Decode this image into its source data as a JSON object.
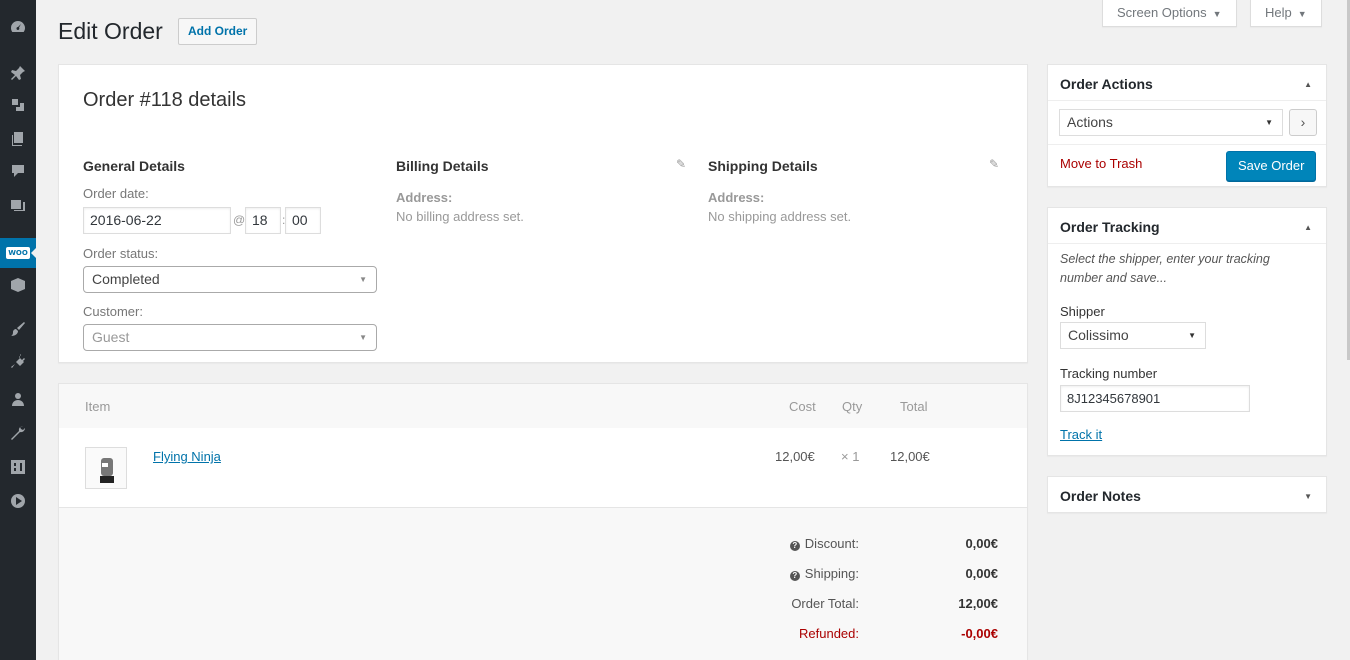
{
  "header": {
    "title": "Edit Order",
    "add_order": "Add Order",
    "screen_options": "Screen Options",
    "help": "Help",
    "dropdown_glyph": "▼"
  },
  "order": {
    "title": "Order #118 details",
    "general": {
      "heading": "General Details",
      "date_label": "Order date:",
      "date": "2016-06-22",
      "at": "@",
      "hour": "18",
      "colon": ":",
      "minute": "00",
      "status_label": "Order status:",
      "status": "Completed",
      "customer_label": "Customer:",
      "customer_placeholder": "Guest"
    },
    "billing": {
      "heading": "Billing Details",
      "address_label": "Address:",
      "address": "No billing address set."
    },
    "shipping": {
      "heading": "Shipping Details",
      "address_label": "Address:",
      "address": "No shipping address set."
    }
  },
  "items": {
    "columns": {
      "item": "Item",
      "cost": "Cost",
      "qty": "Qty",
      "total": "Total"
    },
    "rows": [
      {
        "name": "Flying Ninja",
        "cost": "12,00€",
        "qty": "× 1",
        "total": "12,00€"
      }
    ],
    "totals": {
      "discount_label": "Discount:",
      "discount": "0,00€",
      "shipping_label": "Shipping:",
      "shipping": "0,00€",
      "order_total_label": "Order Total:",
      "order_total": "12,00€",
      "refunded_label": "Refunded:",
      "refunded": "-0,00€"
    }
  },
  "order_actions": {
    "title": "Order Actions",
    "select_value": "Actions",
    "go": "›",
    "trash": "Move to Trash",
    "save": "Save Order"
  },
  "order_tracking": {
    "title": "Order Tracking",
    "note": "Select the shipper, enter your tracking number and save...",
    "shipper_label": "Shipper",
    "shipper": "Colissimo",
    "tracking_label": "Tracking number",
    "tracking_number": "8J12345678901",
    "track_link": "Track it"
  },
  "order_notes": {
    "title": "Order Notes"
  },
  "icons": {
    "menu": [
      "dashboard-icon",
      "pin-icon",
      "media-icon",
      "pages-icon",
      "comments-icon",
      "gallery-icon",
      "woocommerce-icon",
      "products-icon",
      "appearance-icon",
      "plugins-icon",
      "users-icon",
      "tools-icon",
      "settings-icon",
      "play-icon"
    ],
    "collapse": "▲",
    "expand": "▼",
    "pencil": "✎",
    "help": "?"
  },
  "colors": {
    "accent": "#0073aa",
    "primary_button": "#0085ba",
    "danger": "#aa0000",
    "sidebar": "#23282d"
  }
}
